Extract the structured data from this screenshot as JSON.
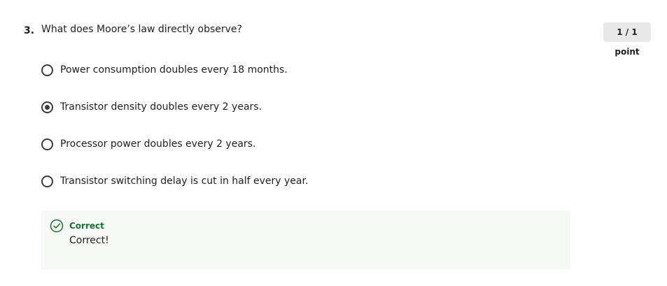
{
  "question": {
    "number": "3.",
    "text": "What does Moore’s law directly observe?",
    "score": "1 / 1 point"
  },
  "options": [
    {
      "label": "Power consumption doubles every 18 months.",
      "selected": false
    },
    {
      "label": "Transistor density doubles every 2 years.",
      "selected": true
    },
    {
      "label": "Processor power doubles every 2 years.",
      "selected": false
    },
    {
      "label": "Transistor switching delay is cut in half every year.",
      "selected": false
    }
  ],
  "feedback": {
    "icon": "check-circle-icon",
    "title": "Correct",
    "text": "Correct!",
    "accent_color": "#137333",
    "background_color": "#f7f9f6"
  },
  "colors": {
    "radio_border": "#3c3c3c",
    "score_badge_background": "#e8e8e8"
  }
}
